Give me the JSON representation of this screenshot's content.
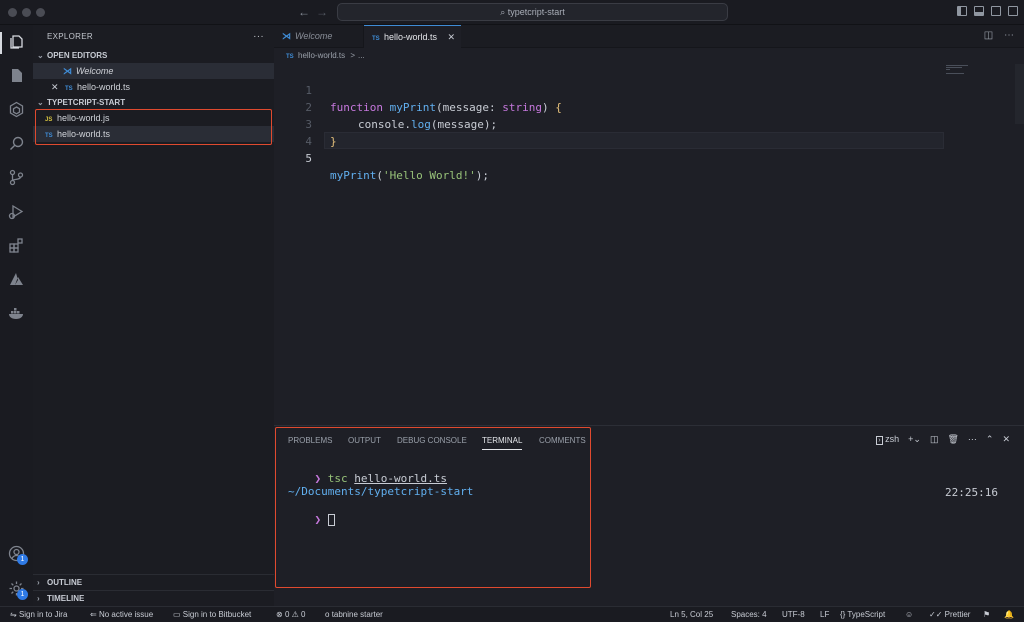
{
  "window": {
    "search_text": "typetcript-start"
  },
  "sidebar": {
    "title": "EXPLORER",
    "more": "···",
    "open_editors_label": "OPEN EDITORS",
    "open_editors": [
      {
        "label": "Welcome",
        "icon": "vscode-icon"
      },
      {
        "label": "hello-world.ts",
        "icon": "typescript-file-icon",
        "badge": "TS",
        "close": "✕"
      }
    ],
    "project_label": "TYPETCRIPT-START",
    "files": [
      {
        "label": "hello-world.js",
        "badge": "JS"
      },
      {
        "label": "hello-world.ts",
        "badge": "TS"
      }
    ],
    "outline_label": "OUTLINE",
    "timeline_label": "TIMELINE"
  },
  "tabs": [
    {
      "label": "Welcome"
    },
    {
      "label": "hello-world.ts",
      "badge": "TS",
      "close": "✕"
    }
  ],
  "breadcrumb": {
    "badge": "TS",
    "file": "hello-world.ts",
    "sep": ">",
    "rest": "..."
  },
  "editor": {
    "line_numbers": [
      "1",
      "2",
      "3",
      "4",
      "5"
    ],
    "lines": [
      {
        "kw": "function",
        "fn": "myPrint",
        "p1": "(",
        "arg": "message",
        "colon": ": ",
        "type": "string",
        "p2": ") ",
        "br": "{"
      },
      {
        "obj": "console",
        "dot": ".",
        "fn": "log",
        "p1": "(",
        "arg": "message",
        "p2": ");"
      },
      {
        "br": "}"
      },
      {},
      {
        "fn": "myPrint",
        "p1": "(",
        "str": "'Hello World!'",
        "p2": ");"
      }
    ]
  },
  "panel": {
    "tabs": [
      "PROBLEMS",
      "OUTPUT",
      "DEBUG CONSOLE",
      "TERMINAL",
      "COMMENTS"
    ],
    "active_tab": "TERMINAL",
    "shell": "zsh",
    "terminal": {
      "prompt_symbol": "❯",
      "command": "tsc",
      "command_arg": "hello-world.ts",
      "path": "~/Documents/typetcript-start",
      "time": "22:25:16"
    }
  },
  "status": {
    "jira": "Sign in to Jira",
    "issue": "No active issue",
    "bitbucket": "Sign in to Bitbucket",
    "errors": "0",
    "warnings": "0",
    "tabnine": "tabnine starter",
    "cursor_pos": "Ln 5, Col 25",
    "spaces": "Spaces: 4",
    "encoding": "UTF-8",
    "eol": "LF",
    "language": "TypeScript",
    "prettier": "Prettier"
  },
  "accounts_badge": "1",
  "settings_badge": "1"
}
